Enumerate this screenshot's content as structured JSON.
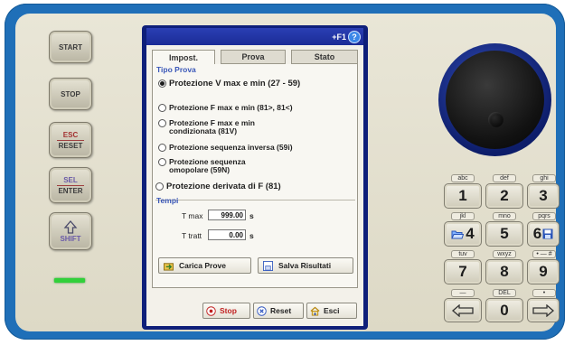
{
  "hardkeys": {
    "start": "START",
    "stop": "STOP",
    "esc_reset": [
      "ESC",
      "RESET"
    ],
    "sel_enter": [
      "SEL",
      "ENTER"
    ],
    "shift": "SHIFT"
  },
  "screen": {
    "f1": "+F1",
    "help": "?",
    "tabs": [
      "Impost.",
      "Prova",
      "Stato"
    ],
    "tipo_prova": {
      "title": "Tipo Prova",
      "options": [
        {
          "label": "Protezione V max e min (27 - 59)",
          "selected": true
        },
        {
          "label": "Protezione F max e min (81>, 81<)",
          "selected": false
        },
        {
          "label": "Protezione F max e min\ncondizionata (81V)",
          "selected": false
        },
        {
          "label": "Protezione sequenza inversa (59i)",
          "selected": false
        },
        {
          "label": "Protezione sequenza\nomopolare (59N)",
          "selected": false
        },
        {
          "label": "Protezione derivata di F (81)",
          "selected": false
        }
      ]
    },
    "tempi": {
      "title": "Tempi",
      "tmax_label": "T max",
      "tmax_value": "999.00",
      "tmax_unit": "s",
      "tratt_label": "T tratt",
      "tratt_value": "0.00",
      "tratt_unit": "s"
    },
    "buttons": {
      "carica": "Carica Prove",
      "salva": "Salva Risultati",
      "stop": "Stop",
      "reset": "Reset",
      "esci": "Esci"
    }
  },
  "keypad": [
    {
      "cap": "abc",
      "label": "1"
    },
    {
      "cap": "def",
      "label": "2"
    },
    {
      "cap": "ghi",
      "label": "3"
    },
    {
      "cap": "jkl",
      "label": "4"
    },
    {
      "cap": "mno",
      "label": "5"
    },
    {
      "cap": "pqrs",
      "label": "6"
    },
    {
      "cap": "tuv",
      "label": "7"
    },
    {
      "cap": "wxyz",
      "label": "8"
    },
    {
      "cap": "• — #",
      "label": "9"
    },
    {
      "cap": "—",
      "label": "left-arrow"
    },
    {
      "cap": "DEL",
      "label": "0"
    },
    {
      "cap": "•",
      "label": "right-arrow"
    }
  ],
  "colors": {
    "frame": "#1f6fb8",
    "panel": "#e9e6d7",
    "screen_title": "#2a3fb4",
    "group_title": "#3a57b8",
    "led": "#31d03a",
    "stop_text": "#c02020"
  }
}
